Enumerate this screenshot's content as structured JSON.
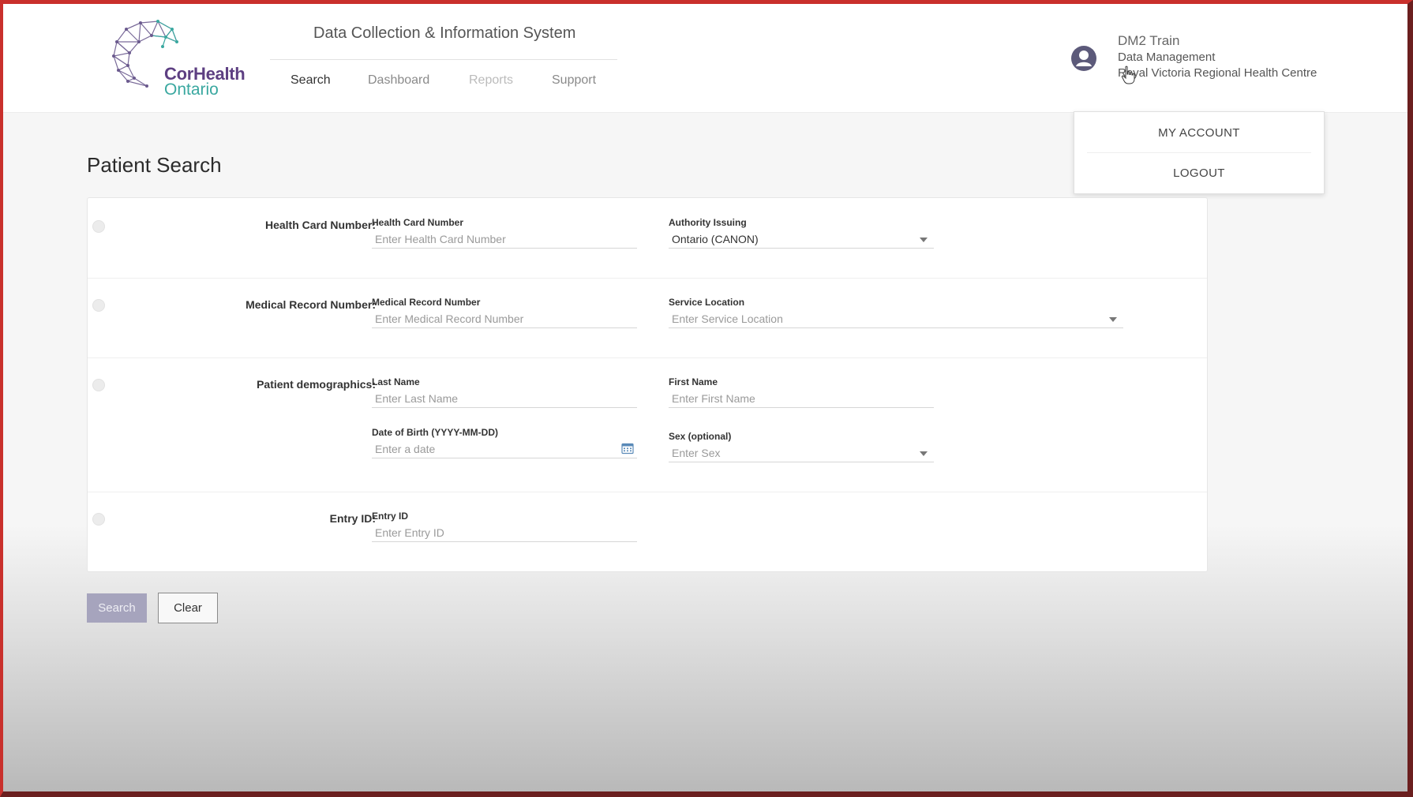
{
  "app": {
    "brand_line1": "CorHealth",
    "brand_line2": "Ontario",
    "system_title": "Data Collection & Information System"
  },
  "nav": {
    "items": [
      {
        "label": "Search"
      },
      {
        "label": "Dashboard"
      },
      {
        "label": "Reports"
      },
      {
        "label": "Support"
      }
    ]
  },
  "user": {
    "name": "DM2 Train",
    "role": "Data Management",
    "organization": "Royal Victoria Regional Health Centre"
  },
  "account_menu": {
    "items": [
      {
        "label": "MY ACCOUNT"
      },
      {
        "label": "LOGOUT"
      }
    ]
  },
  "page": {
    "title": "Patient Search"
  },
  "form": {
    "health_card": {
      "row_label": "Health Card Number:",
      "number_label": "Health Card Number",
      "number_placeholder": "Enter Health Card Number",
      "authority_label": "Authority Issuing",
      "authority_value": "Ontario (CANON)"
    },
    "medical_record": {
      "row_label": "Medical Record Number:",
      "number_label": "Medical Record Number",
      "number_placeholder": "Enter Medical Record Number",
      "location_label": "Service Location",
      "location_placeholder": "Enter Service Location"
    },
    "demographics": {
      "row_label": "Patient demographics:",
      "last_name_label": "Last Name",
      "last_name_placeholder": "Enter Last Name",
      "first_name_label": "First Name",
      "first_name_placeholder": "Enter First Name",
      "dob_label": "Date of Birth (YYYY-MM-DD)",
      "dob_placeholder": "Enter a date",
      "sex_label": "Sex (optional)",
      "sex_placeholder": "Enter Sex"
    },
    "entry_id": {
      "row_label": "Entry ID:",
      "label": "Entry ID",
      "placeholder": "Enter Entry ID"
    }
  },
  "buttons": {
    "search": "Search",
    "clear": "Clear"
  },
  "colors": {
    "brand_purple": "#5d3f82",
    "brand_teal": "#3aa8a0",
    "search_button": "#a6a4bd",
    "avatar": "#5c5a7a"
  },
  "icons": {
    "avatar": "user-circle-icon",
    "calendar": "calendar-icon",
    "dropdown": "chevron-down-icon",
    "cursor": "hand-pointer-icon"
  }
}
